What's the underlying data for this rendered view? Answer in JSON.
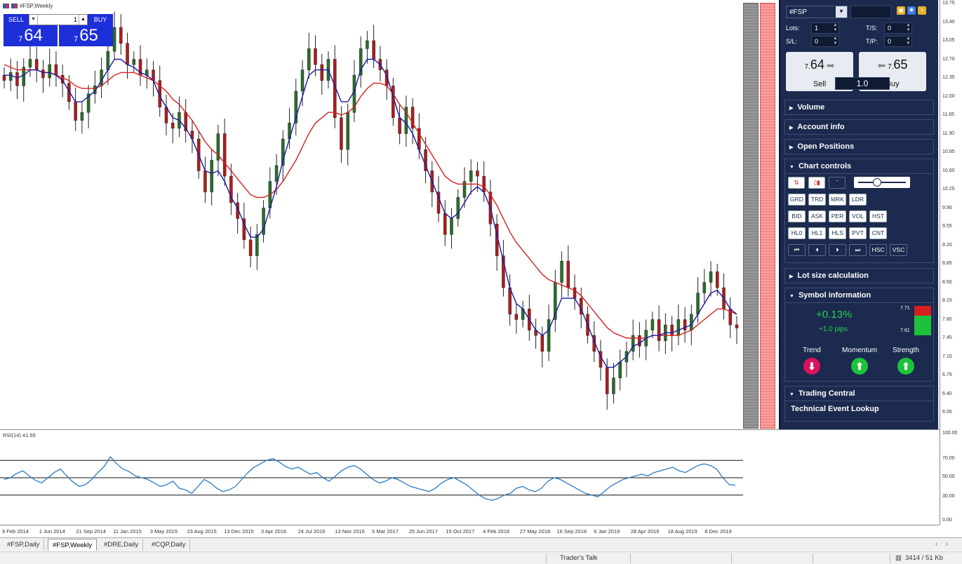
{
  "window": {
    "chart_title": "#FSP,Weekly"
  },
  "trade_widget": {
    "sell_label": "SELL",
    "buy_label": "BUY",
    "lots_value": "1",
    "sell_price_small": "7",
    "sell_price_big": "64",
    "buy_price_small": "7",
    "buy_price_big": "65"
  },
  "price_axis": [
    "13.75",
    "13.40",
    "13.05",
    "12.70",
    "12.35",
    "12.00",
    "11.65",
    "11.30",
    "10.95",
    "10.60",
    "10.25",
    "9.90",
    "9.55",
    "9.20",
    "8.85",
    "8.50",
    "8.15",
    "7.80",
    "7.45",
    "7.10",
    "6.75",
    "6.40",
    "6.05"
  ],
  "rsi_axis": [
    "100.00",
    "70.00",
    "50.00",
    "30.00",
    "0.00"
  ],
  "rsi_label": "RSI(14) 41.55",
  "time_axis": [
    "9 Feb 2014",
    "1 Jun 2014",
    "21 Sep 2014",
    "11 Jan 2015",
    "3 May 2015",
    "23 Aug 2015",
    "13 Dec 2015",
    "3 Apr 2016",
    "24 Jul 2016",
    "13 Nov 2016",
    "5 Mar 2017",
    "25 Jun 2017",
    "15 Oct 2017",
    "4 Feb 2018",
    "27 May 2018",
    "16 Sep 2018",
    "6 Jan 2019",
    "28 Apr 2019",
    "18 Aug 2019",
    "8 Dec 2019"
  ],
  "side_panel": {
    "symbol": "#FSP",
    "lots_label": "Lots:",
    "lots_value": "1",
    "ts_label": "T/S:",
    "ts_value": "0",
    "sl_label": "S/L:",
    "sl_value": "0",
    "tp_label": "T/P:",
    "tp_value": "0",
    "sell_price_small": "7.",
    "sell_price_big": "64",
    "buy_price_small": "7.",
    "buy_price_big": "65",
    "sell_label": "Sell",
    "buy_label": "Buy",
    "lot_size": "1.0",
    "sections": {
      "volume": "Volume",
      "account_info": "Account info",
      "open_positions": "Open Positions",
      "chart_controls": "Chart controls",
      "lot_size_calc": "Lot size calculation",
      "symbol_info": "Symbol information",
      "trading_central": "Trading Central"
    },
    "cc_buttons_row1": [
      "GRD",
      "TRD",
      "MRK",
      "LDR"
    ],
    "cc_buttons_row2": [
      "BID",
      "ASK",
      "PER",
      "VOL",
      "HST"
    ],
    "cc_buttons_row3": [
      "HL0",
      "HL1",
      "HLS",
      "PVT",
      "CNT"
    ],
    "cc_buttons_row4": [
      "⏮",
      "⏴",
      "⏵",
      "⏭",
      "HSC",
      "VSC"
    ],
    "change_pct": "+0.13%",
    "change_pips": "+1.0 pips",
    "high": "7.71",
    "low": "7.61",
    "trend_label": "Trend",
    "momentum_label": "Momentum",
    "strength_label": "Strength",
    "trend_dir": "down",
    "momentum_dir": "up",
    "strength_dir": "up",
    "technical_event_lookup": "Technical Event Lookup"
  },
  "tabs": [
    "#FSP,Daily",
    "#FSP,Weekly",
    "#DRE,Daily",
    "#CQP,Daily"
  ],
  "active_tab": "#FSP,Weekly",
  "status": {
    "traders_talk": "Trader's Talk",
    "traffic": "3414 / 51 Kb"
  },
  "colors": {
    "fast_ma": "#1a1aa8",
    "slow_ma": "#d62020",
    "rsi_line": "#2a7bc4",
    "bull": "#2a6f2a",
    "bear": "#b01c1c"
  },
  "chart_data": {
    "type": "candlestick",
    "title": "#FSP,Weekly",
    "ylim": [
      6.05,
      13.75
    ],
    "close_series": [
      12.3,
      12.45,
      12.2,
      12.55,
      12.7,
      12.5,
      12.35,
      12.6,
      12.4,
      12.25,
      11.9,
      11.55,
      11.7,
      12.05,
      12.2,
      12.5,
      12.85,
      13.3,
      13.0,
      12.6,
      12.7,
      12.4,
      12.5,
      12.3,
      11.8,
      11.5,
      11.4,
      11.7,
      11.35,
      11.2,
      10.6,
      10.2,
      10.8,
      11.3,
      10.5,
      10.0,
      9.7,
      9.3,
      9.0,
      9.4,
      9.9,
      10.4,
      10.7,
      11.2,
      11.5,
      12.1,
      12.5,
      12.9,
      12.6,
      12.3,
      12.7,
      11.6,
      11.0,
      11.7,
      12.4,
      12.9,
      13.05,
      12.7,
      12.5,
      12.2,
      11.6,
      11.3,
      11.8,
      11.4,
      11.0,
      10.6,
      10.2,
      9.8,
      9.4,
      9.7,
      10.1,
      10.4,
      10.6,
      10.5,
      10.2,
      9.6,
      9.0,
      8.4,
      7.9,
      7.8,
      8.0,
      7.6,
      7.5,
      7.2,
      7.8,
      8.5,
      8.9,
      8.4,
      8.2,
      7.9,
      7.5,
      7.2,
      6.9,
      6.4,
      6.7,
      7.0,
      7.2,
      7.5,
      7.3,
      7.6,
      7.8,
      7.4,
      7.7,
      7.5,
      7.8,
      7.6,
      7.9,
      8.3,
      8.5,
      8.7,
      8.4,
      8.0,
      7.7,
      7.64
    ],
    "rsi_series": [
      48,
      50,
      55,
      58,
      52,
      47,
      44,
      50,
      56,
      60,
      52,
      45,
      40,
      42,
      48,
      56,
      63,
      74,
      66,
      60,
      57,
      52,
      50,
      48,
      44,
      40,
      42,
      46,
      38,
      36,
      32,
      40,
      48,
      44,
      38,
      34,
      36,
      40,
      48,
      56,
      62,
      66,
      70,
      72,
      68,
      63,
      60,
      62,
      58,
      54,
      56,
      50,
      46,
      52,
      58,
      62,
      64,
      60,
      54,
      48,
      44,
      46,
      50,
      48,
      44,
      40,
      38,
      36,
      34,
      38,
      44,
      48,
      50,
      46,
      42,
      36,
      30,
      26,
      24,
      26,
      30,
      32,
      38,
      40,
      36,
      34,
      38,
      46,
      50,
      48,
      44,
      40,
      36,
      32,
      30,
      28,
      34,
      40,
      44,
      48,
      50,
      52,
      54,
      52,
      56,
      58,
      60,
      62,
      58,
      56,
      60,
      64,
      66,
      64,
      60,
      50,
      42,
      41.55
    ],
    "ma_fast": [
      12.4,
      12.4,
      12.35,
      12.4,
      12.5,
      12.5,
      12.45,
      12.45,
      12.4,
      12.3,
      12.1,
      11.9,
      11.9,
      12.0,
      12.1,
      12.3,
      12.5,
      12.7,
      12.7,
      12.6,
      12.55,
      12.45,
      12.4,
      12.3,
      12.0,
      11.8,
      11.6,
      11.55,
      11.4,
      11.2,
      10.9,
      10.6,
      10.55,
      10.6,
      10.4,
      10.1,
      9.9,
      9.6,
      9.35,
      9.35,
      9.5,
      9.9,
      10.3,
      10.8,
      11.2,
      11.6,
      12.0,
      12.4,
      12.5,
      12.5,
      12.5,
      12.2,
      11.9,
      11.9,
      12.1,
      12.5,
      12.7,
      12.7,
      12.6,
      12.4,
      12.0,
      11.6,
      11.5,
      11.3,
      11.0,
      10.7,
      10.4,
      10.1,
      9.8,
      9.7,
      9.8,
      10.0,
      10.2,
      10.3,
      10.2,
      9.9,
      9.4,
      8.9,
      8.4,
      8.1,
      8.0,
      7.8,
      7.6,
      7.5,
      7.6,
      7.9,
      8.2,
      8.2,
      8.2,
      8.0,
      7.7,
      7.4,
      7.1,
      6.9,
      6.9,
      7.0,
      7.1,
      7.3,
      7.35,
      7.45,
      7.5,
      7.5,
      7.55,
      7.55,
      7.6,
      7.65,
      7.7,
      7.9,
      8.1,
      8.3,
      8.35,
      8.2,
      8.0,
      7.9
    ],
    "ma_slow": [
      12.6,
      12.55,
      12.5,
      12.5,
      12.5,
      12.5,
      12.45,
      12.45,
      12.4,
      12.35,
      12.3,
      12.2,
      12.15,
      12.15,
      12.15,
      12.2,
      12.3,
      12.4,
      12.45,
      12.45,
      12.45,
      12.4,
      12.35,
      12.3,
      12.2,
      12.1,
      11.95,
      11.85,
      11.7,
      11.55,
      11.35,
      11.15,
      11.0,
      10.9,
      10.75,
      10.6,
      10.45,
      10.3,
      10.15,
      10.1,
      10.1,
      10.15,
      10.25,
      10.4,
      10.6,
      10.8,
      11.05,
      11.3,
      11.5,
      11.6,
      11.7,
      11.7,
      11.65,
      11.7,
      11.8,
      12.0,
      12.15,
      12.25,
      12.25,
      12.2,
      12.05,
      11.85,
      11.7,
      11.5,
      11.3,
      11.1,
      10.9,
      10.7,
      10.5,
      10.4,
      10.35,
      10.35,
      10.35,
      10.35,
      10.3,
      10.15,
      9.95,
      9.7,
      9.45,
      9.25,
      9.1,
      8.95,
      8.8,
      8.65,
      8.55,
      8.5,
      8.45,
      8.4,
      8.35,
      8.25,
      8.1,
      7.95,
      7.8,
      7.65,
      7.55,
      7.5,
      7.45,
      7.45,
      7.45,
      7.45,
      7.5,
      7.5,
      7.5,
      7.5,
      7.5,
      7.55,
      7.6,
      7.7,
      7.8,
      7.9,
      8.0,
      8.0,
      7.95,
      7.9
    ]
  }
}
